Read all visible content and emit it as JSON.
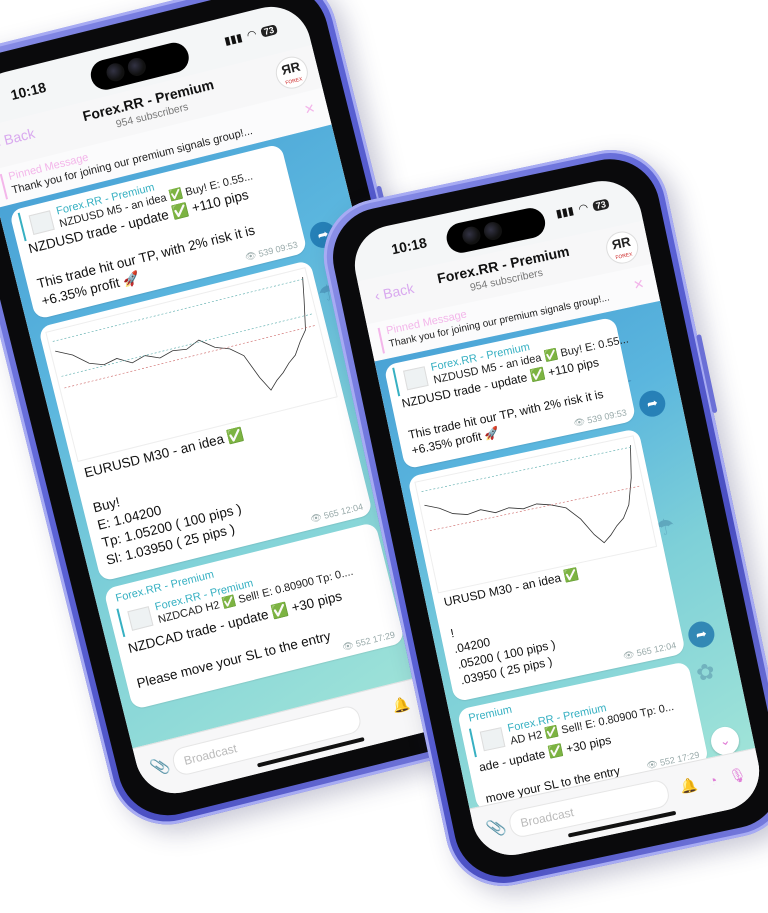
{
  "colors": {
    "accent": "#36b0c2",
    "pink": "#f3b6ea",
    "chat_bg": "#5bb6de"
  },
  "phones": [
    {
      "status": {
        "time": "10:18",
        "battery": "73"
      },
      "header": {
        "back": "Back",
        "title": "Forex.RR - Premium",
        "subtitle": "954 subscribers",
        "logo": "ЯR",
        "logo_sub": "FOREX"
      },
      "pinned": {
        "label": "Pinned Message",
        "text": "Thank you for joining our premium signals group!..."
      },
      "messages": [
        {
          "quote_name": "Forex.RR - Premium",
          "quote_text": "NZDUSD M5 - an idea ✅ Buy! E: 0.55...",
          "text": "NZDUSD trade - update ✅ +110 pips\n\nThis trade hit our TP, with 2% risk it is\n+6.35% profit 🚀",
          "views": "539",
          "time": "09:53"
        },
        {
          "text": "EURUSD M30 - an idea ✅\n\nBuy!\n E: 1.04200\n Tp: 1.05200 ( 100 pips )\n Sl: 1.03950 ( 25 pips )",
          "views": "565",
          "time": "12:04"
        },
        {
          "sender": "Forex.RR - Premium",
          "quote_name": "Forex.RR - Premium",
          "quote_text": "NZDCAD H2 ✅ Sell! E: 0.80900 Tp: 0....",
          "text": "NZDCAD trade - update ✅ +30 pips\n\nPlease move your SL to the entry",
          "views": "552",
          "time": "17:29"
        }
      ],
      "composer": {
        "placeholder": "Broadcast"
      }
    },
    {
      "status": {
        "time": "10:18",
        "battery": "73"
      },
      "header": {
        "back": "Back",
        "title": "Forex.RR - Premium",
        "subtitle": "954 subscribers",
        "logo": "ЯR",
        "logo_sub": "FOREX"
      },
      "pinned": {
        "label": "Pinned Message",
        "text": "Thank you for joining our premium signals group!..."
      },
      "messages": [
        {
          "quote_name": "Forex.RR - Premium",
          "quote_text": "NZDUSD M5 - an idea ✅ Buy! E: 0.55...",
          "text": "NZDUSD trade - update ✅ +110 pips\n\nThis trade hit our TP, with 2% risk it is\n+6.35% profit 🚀",
          "views": "539",
          "time": "09:53"
        },
        {
          "text": "URUSD M30 - an idea ✅\n\n!\n.04200\n.05200 ( 100 pips )\n.03950 ( 25 pips )",
          "views": "565",
          "time": "12:04"
        },
        {
          "sender": "Premium",
          "quote_name": "Forex.RR - Premium",
          "quote_text": "AD H2 ✅ Sell! E: 0.80900 Tp: 0...",
          "text": "ade - update ✅ +30 pips\n\nmove your SL to the entry",
          "views": "552",
          "time": "17:29"
        }
      ],
      "composer": {
        "placeholder": "Broadcast"
      }
    }
  ]
}
